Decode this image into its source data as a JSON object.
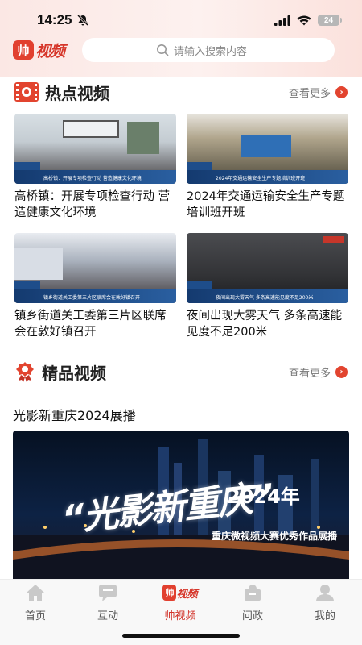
{
  "status_bar": {
    "time": "14:25",
    "battery": "24"
  },
  "header": {
    "logo_badge": "帅",
    "logo_text": "视频",
    "search_placeholder": "请输入搜索内容"
  },
  "hot_section": {
    "title": "热点视频",
    "more": "查看更多",
    "videos": [
      {
        "title": "高桥镇：开展专项检查行动 营造健康文化环境",
        "caption": "高桥镇：开展专项检查行动 营造健康文化环境",
        "bg": "#cbd5db"
      },
      {
        "title": "2024年交通运输安全生产专题培训班开班",
        "caption": "2024年交通运输安全生产专题培训班开班",
        "bg": "#6f6a55"
      },
      {
        "title": "镇乡街道关工委第三片区联席会在敦好镇召开",
        "caption": "镇乡街道关工委第三片区联席会在敦好镇召开",
        "bg": "#bfc4cd"
      },
      {
        "title": "夜间出现大雾天气 多条高速能见度不足200米",
        "caption": "夜间出现大雾天气 多条高速能见度不足200米",
        "bg": "#3a3b3f"
      }
    ]
  },
  "premium_section": {
    "title": "精品视频",
    "more": "查看更多",
    "featured_title": "光影新重庆2024展播",
    "banner_calligraphy": "“光影新重庆”",
    "banner_year": "2024年",
    "banner_subtitle": "重庆微视频大赛优秀作品展播"
  },
  "bottom_nav": [
    {
      "label": "首页",
      "icon": "home-icon"
    },
    {
      "label": "互动",
      "icon": "chat-icon"
    },
    {
      "label": "帅视频",
      "icon": "shuai-video-logo-icon"
    },
    {
      "label": "问政",
      "icon": "inquiry-icon"
    },
    {
      "label": "我的",
      "icon": "profile-icon"
    }
  ],
  "colors": {
    "accent": "#d6362a",
    "nav_inactive": "#555555"
  }
}
